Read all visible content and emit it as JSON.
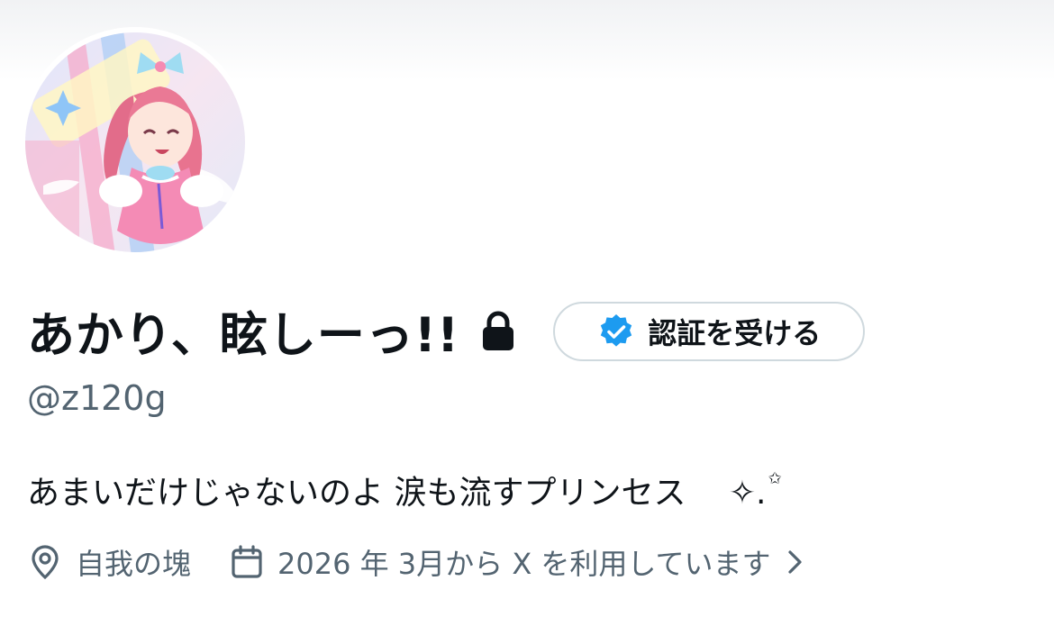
{
  "profile": {
    "display_name": "あかり、眩しーっ!!",
    "handle": "@z120g",
    "bio": "あまいだけじゃないのよ 涙も流すプリンセス　 ✧.",
    "bio_sparkle": "✩",
    "location": "自我の塊",
    "joined": "2026 年 3月から X を利用しています",
    "protected_icon": "lock-icon",
    "avatar_icon": "anime-girl-avatar"
  },
  "verify_button": {
    "label": "認証を受ける",
    "icon": "verified-badge-icon"
  },
  "colors": {
    "text_primary": "#0f1419",
    "text_secondary": "#536471",
    "verified_blue": "#1d9bf0",
    "border": "#cfd9de"
  }
}
